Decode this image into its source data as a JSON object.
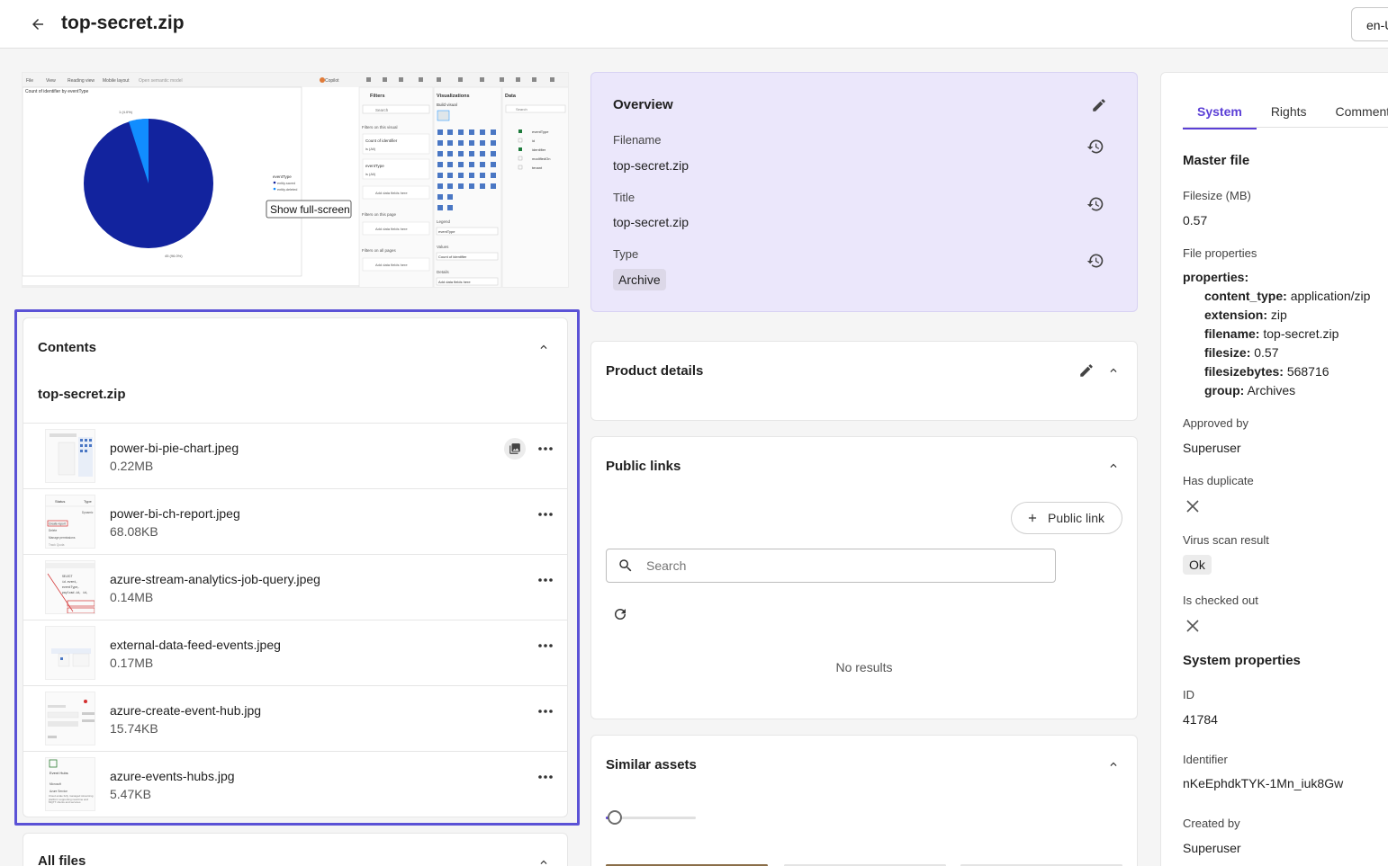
{
  "header": {
    "title": "top-secret.zip",
    "language": "en-US"
  },
  "preview": {
    "chart_title": "Count of identifier by eventType",
    "tooltip": "Show full-screen",
    "menu": [
      "File",
      "View",
      "Reading view",
      "Mobile layout",
      "Open semantic model"
    ],
    "copilot": "Copilot",
    "filters_title": "Filters",
    "visualizations_title": "Visualizations",
    "data_title": "Data",
    "build_visual": "Build visual",
    "search": "Search",
    "filters_on_visual": "Filters on this visual",
    "filter1": "Count of identifier",
    "filter1_val": "is (All)",
    "filter2": "eventType",
    "filter2_val": "is (All)",
    "add_fields": "Add data fields here",
    "filters_on_page": "Filters on this page",
    "filters_on_all": "Filters on all pages",
    "legend": "Legend",
    "legend_field": "eventType",
    "values": "Values",
    "values_field": "Count of identifier",
    "details": "Details",
    "data_fields": [
      "eventType",
      "id",
      "identifier",
      "modifiedOn",
      "tenant"
    ],
    "legend_title": "eventType",
    "legend_items": [
      "entity.saved",
      "entity.deleted"
    ],
    "pie_label_small": "1 (4.0%)",
    "pie_label_big": "45 (96.0%)"
  },
  "contents": {
    "title": "Contents",
    "zip_name": "top-secret.zip",
    "files": [
      {
        "name": "power-bi-pie-chart.jpeg",
        "size": "0.22MB"
      },
      {
        "name": "power-bi-ch-report.jpeg",
        "size": "68.08KB"
      },
      {
        "name": "azure-stream-analytics-job-query.jpeg",
        "size": "0.14MB"
      },
      {
        "name": "external-data-feed-events.jpeg",
        "size": "0.17MB"
      },
      {
        "name": "azure-create-event-hub.jpg",
        "size": "15.74KB"
      },
      {
        "name": "azure-events-hubs.jpg",
        "size": "5.47KB"
      }
    ],
    "thumb_texts": {
      "report_status": "Status",
      "report_type": "Type",
      "report_create": "Create report",
      "report_delete": "Delete",
      "report_manage": "Manage permissions",
      "report_enable": "Dynamic",
      "report_share": "Track Quota",
      "query_line1": "SELECT",
      "query_line2": "id.event,",
      "query_line3": "eventType,",
      "query_line4": "payload.id, id,",
      "eventhub_title": "Event Hubs",
      "eventhub_vendor": "Microsoft",
      "eventhub_service": "Azure Service",
      "eventhub_desc": "Cloud-scale fully managed streaming platform supporting real-time and MQTT clients and services"
    }
  },
  "all_files": {
    "title": "All files"
  },
  "overview": {
    "title": "Overview",
    "filename_label": "Filename",
    "filename": "top-secret.zip",
    "title_label": "Title",
    "title_value": "top-secret.zip",
    "type_label": "Type",
    "type_value": "Archive"
  },
  "product_details": {
    "title": "Product details"
  },
  "public_links": {
    "title": "Public links",
    "add_button": "Public link",
    "search_placeholder": "Search",
    "no_results": "No results"
  },
  "similar_assets": {
    "title": "Similar assets",
    "slider_value": 0.1
  },
  "right_panel": {
    "tabs": [
      "System",
      "Rights",
      "Comments"
    ],
    "active_tab": "System",
    "master_file": "Master file",
    "filesize_label": "Filesize (MB)",
    "filesize": "0.57",
    "file_props_label": "File properties",
    "properties_key": "properties:",
    "props": [
      {
        "k": "content_type:",
        "v": "application/zip"
      },
      {
        "k": "extension:",
        "v": "zip"
      },
      {
        "k": "filename:",
        "v": "top-secret.zip"
      },
      {
        "k": "filesize:",
        "v": "0.57"
      },
      {
        "k": "filesizebytes:",
        "v": "568716"
      },
      {
        "k": "group:",
        "v": "Archives"
      }
    ],
    "approved_label": "Approved by",
    "approved": "Superuser",
    "duplicate_label": "Has duplicate",
    "virus_label": "Virus scan result",
    "virus": "Ok",
    "checked_out_label": "Is checked out",
    "system_props": "System properties",
    "id_label": "ID",
    "id": "41784",
    "identifier_label": "Identifier",
    "identifier": "nKeEphdkTYK-1Mn_iuk8Gw",
    "created_label": "Created by",
    "created": "Superuser"
  },
  "colors": {
    "accent": "#5b3fd6",
    "focus_border": "#5b52d6",
    "overview_bg": "#ebe7fb",
    "pie_main": "#12239e",
    "pie_small": "#118dff"
  }
}
